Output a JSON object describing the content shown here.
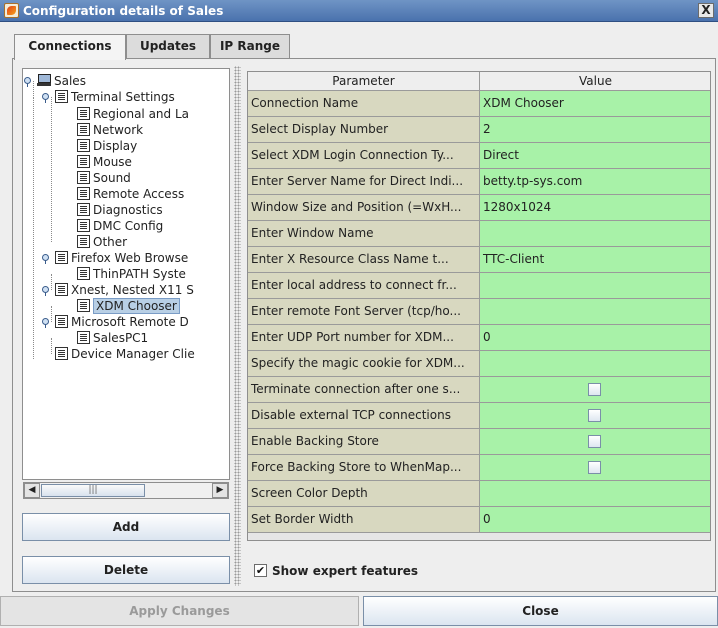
{
  "window": {
    "title": "Configuration details of Sales",
    "close_label": "X"
  },
  "tabs": [
    {
      "label": "Connections",
      "active": true
    },
    {
      "label": "Updates",
      "active": false
    },
    {
      "label": "IP Range",
      "active": false
    }
  ],
  "tree": {
    "items": [
      {
        "label": "Sales",
        "icon": "computer-icon",
        "expanded": true
      },
      {
        "label": "Terminal Settings",
        "icon": "document-icon",
        "expanded": true
      },
      {
        "label": "Regional and La",
        "icon": "document-icon"
      },
      {
        "label": "Network",
        "icon": "document-icon"
      },
      {
        "label": "Display",
        "icon": "document-icon"
      },
      {
        "label": "Mouse",
        "icon": "document-icon"
      },
      {
        "label": "Sound",
        "icon": "document-icon"
      },
      {
        "label": "Remote Access",
        "icon": "document-icon"
      },
      {
        "label": "Diagnostics",
        "icon": "document-icon"
      },
      {
        "label": "DMC Config",
        "icon": "document-icon"
      },
      {
        "label": "Other",
        "icon": "document-icon"
      },
      {
        "label": "Firefox Web Browse",
        "icon": "document-icon",
        "expanded": true
      },
      {
        "label": "ThinPATH Syste",
        "icon": "document-icon"
      },
      {
        "label": "Xnest, Nested X11 S",
        "icon": "document-icon",
        "expanded": true
      },
      {
        "label": "XDM Chooser",
        "icon": "document-icon",
        "selected": true
      },
      {
        "label": "Microsoft Remote D",
        "icon": "document-icon",
        "expanded": true
      },
      {
        "label": "SalesPC1",
        "icon": "document-icon"
      },
      {
        "label": "Device Manager Clie",
        "icon": "document-icon"
      }
    ]
  },
  "scrollbar": {
    "left_arrow": "◀",
    "right_arrow": "▶",
    "grip": "|||"
  },
  "buttons": {
    "add": "Add",
    "delete": "Delete",
    "apply": "Apply Changes",
    "close": "Close"
  },
  "table": {
    "headers": [
      "Parameter",
      "Value"
    ],
    "rows": [
      {
        "param": "Connection Name",
        "value": "XDM Chooser"
      },
      {
        "param": "Select Display Number",
        "value": "2"
      },
      {
        "param": "Select XDM Login Connection Ty...",
        "value": "Direct"
      },
      {
        "param": "Enter Server Name for Direct Indi...",
        "value": "betty.tp-sys.com"
      },
      {
        "param": "Window Size and Position (=WxH...",
        "value": "1280x1024"
      },
      {
        "param": "Enter Window Name",
        "value": ""
      },
      {
        "param": "Enter X Resource Class Name t...",
        "value": "TTC-Client"
      },
      {
        "param": "Enter local address to connect fr...",
        "value": ""
      },
      {
        "param": "Enter remote Font Server (tcp/ho...",
        "value": ""
      },
      {
        "param": "Enter UDP Port number for XDM...",
        "value": "0"
      },
      {
        "param": "Specify the magic cookie for XDM...",
        "value": ""
      },
      {
        "param": "Terminate connection after one s...",
        "value": "",
        "checkbox": true,
        "checked": false
      },
      {
        "param": "Disable external TCP connections",
        "value": "",
        "checkbox": true,
        "checked": false
      },
      {
        "param": "Enable Backing Store",
        "value": "",
        "checkbox": true,
        "checked": false
      },
      {
        "param": "Force Backing Store to WhenMap...",
        "value": "",
        "checkbox": true,
        "checked": false
      },
      {
        "param": "Screen Color Depth",
        "value": ""
      },
      {
        "param": "Set Border Width",
        "value": "0"
      }
    ]
  },
  "expert": {
    "label": "Show expert features",
    "checked": true,
    "check_glyph": "✔"
  },
  "colors": {
    "param_cell": "#d8d8c0",
    "value_cell": "#a8f2a8",
    "titlebar": "#4a72ad"
  }
}
